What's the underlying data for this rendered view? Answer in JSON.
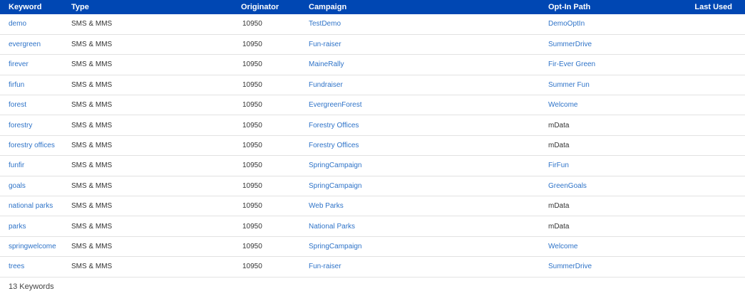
{
  "table": {
    "headers": {
      "keyword": "Keyword",
      "type": "Type",
      "originator": "Originator",
      "campaign": "Campaign",
      "opt_in_path": "Opt-In Path",
      "last_used": "Last Used"
    },
    "rows": [
      {
        "keyword": "demo",
        "type": "SMS & MMS",
        "originator": "10950",
        "campaign": "TestDemo",
        "opt_in_path": "DemoOptIn",
        "opt_in_is_link": true,
        "last_used": ""
      },
      {
        "keyword": "evergreen",
        "type": "SMS & MMS",
        "originator": "10950",
        "campaign": "Fun-raiser",
        "opt_in_path": "SummerDrive",
        "opt_in_is_link": true,
        "last_used": ""
      },
      {
        "keyword": "firever",
        "type": "SMS & MMS",
        "originator": "10950",
        "campaign": "MaineRally",
        "opt_in_path": "Fir-Ever Green",
        "opt_in_is_link": true,
        "last_used": ""
      },
      {
        "keyword": "firfun",
        "type": "SMS & MMS",
        "originator": "10950",
        "campaign": "Fundraiser",
        "opt_in_path": "Summer Fun",
        "opt_in_is_link": true,
        "last_used": ""
      },
      {
        "keyword": "forest",
        "type": "SMS & MMS",
        "originator": "10950",
        "campaign": "EvergreenForest",
        "opt_in_path": "Welcome",
        "opt_in_is_link": true,
        "last_used": ""
      },
      {
        "keyword": "forestry",
        "type": "SMS & MMS",
        "originator": "10950",
        "campaign": "Forestry Offices",
        "opt_in_path": "mData",
        "opt_in_is_link": false,
        "last_used": ""
      },
      {
        "keyword": "forestry offices",
        "type": "SMS & MMS",
        "originator": "10950",
        "campaign": "Forestry Offices",
        "opt_in_path": "mData",
        "opt_in_is_link": false,
        "last_used": ""
      },
      {
        "keyword": "funfir",
        "type": "SMS & MMS",
        "originator": "10950",
        "campaign": "SpringCampaign",
        "opt_in_path": "FirFun",
        "opt_in_is_link": true,
        "last_used": ""
      },
      {
        "keyword": "goals",
        "type": "SMS & MMS",
        "originator": "10950",
        "campaign": "SpringCampaign",
        "opt_in_path": "GreenGoals",
        "opt_in_is_link": true,
        "last_used": ""
      },
      {
        "keyword": "national parks",
        "type": "SMS & MMS",
        "originator": "10950",
        "campaign": "Web Parks",
        "opt_in_path": "mData",
        "opt_in_is_link": false,
        "last_used": ""
      },
      {
        "keyword": "parks",
        "type": "SMS & MMS",
        "originator": "10950",
        "campaign": "National Parks",
        "opt_in_path": "mData",
        "opt_in_is_link": false,
        "last_used": ""
      },
      {
        "keyword": "springwelcome",
        "type": "SMS & MMS",
        "originator": "10950",
        "campaign": "SpringCampaign",
        "opt_in_path": "Welcome",
        "opt_in_is_link": true,
        "last_used": ""
      },
      {
        "keyword": "trees",
        "type": "SMS & MMS",
        "originator": "10950",
        "campaign": "Fun-raiser",
        "opt_in_path": "SummerDrive",
        "opt_in_is_link": true,
        "last_used": ""
      }
    ]
  },
  "footer": {
    "count_label": "13 Keywords"
  },
  "colors": {
    "header_bg": "#0047b3",
    "link": "#2e73c8",
    "text": "#333333",
    "row_border": "#e2e2e2"
  }
}
